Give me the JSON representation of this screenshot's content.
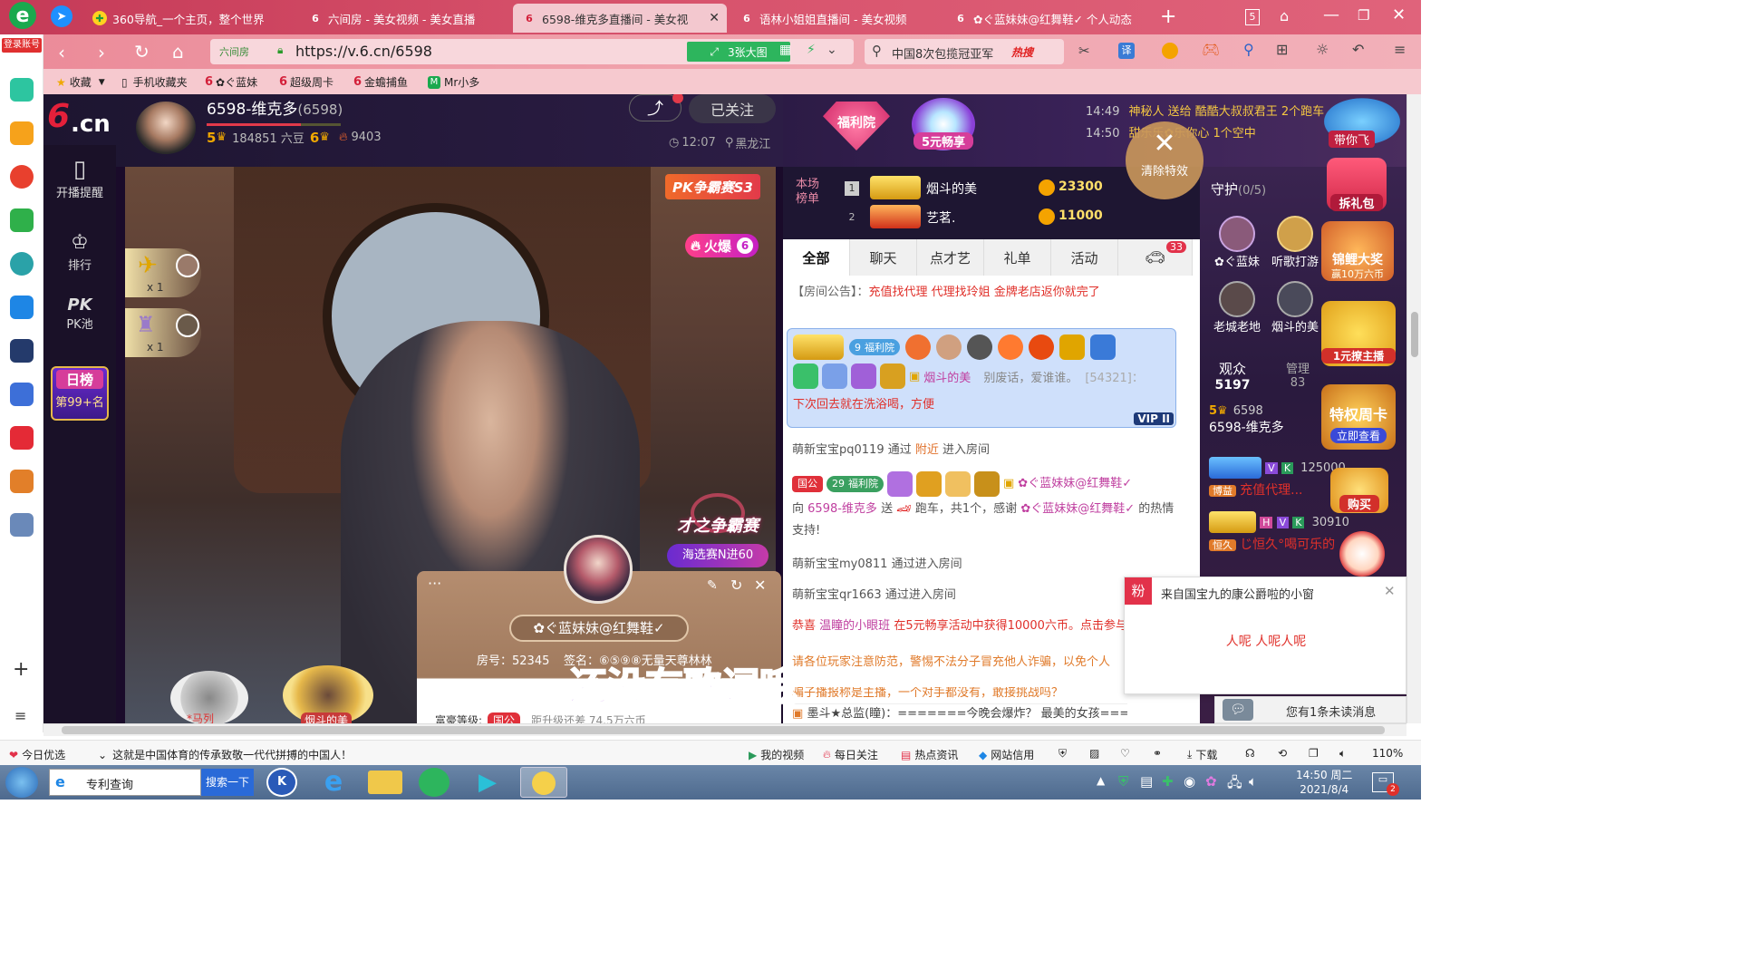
{
  "browser": {
    "login_label": "登录账号",
    "tabs": [
      {
        "label": "360导航_一个主页，整个世界",
        "active": false
      },
      {
        "label": "六间房 - 美女视频 - 美女直播",
        "active": false
      },
      {
        "label": "6598-维克多直播间 - 美女视",
        "active": true
      },
      {
        "label": "语林小姐姐直播间 - 美女视频",
        "active": false
      },
      {
        "label": "✿ぐ蓝妹妹@红舞鞋✓ 个人动态",
        "active": false
      }
    ],
    "tab_count": "5",
    "url": "https://v.6.cn/6598",
    "url_prefix": "六间房",
    "bigpic_label": "3张大图",
    "search_text": "中国8次包揽冠亚军",
    "search_hot": "热搜",
    "translate_label": "译",
    "bookmarks": [
      "收藏",
      "手机收藏夹",
      "✿ぐ蓝妹",
      "超级周卡",
      "金蟾捕鱼",
      "Mr小多"
    ]
  },
  "streamer": {
    "name": "6598-维克多",
    "room_id": "(6598)",
    "level_left": "5",
    "beans": "184851 六豆",
    "level_right": "6",
    "fire": "9403",
    "followed": "已关注",
    "time": "12:07",
    "location": "黑龙江"
  },
  "left_nav": [
    {
      "label": "开播提醒"
    },
    {
      "label": "排行"
    },
    {
      "label": "PK池",
      "title": "PK"
    },
    {
      "label": "日榜",
      "sub": "第99+名"
    }
  ],
  "video": {
    "pk_badge": "PK争霸赛S3",
    "hot_label": "火爆",
    "hot_level": "6",
    "x1a": "x 1",
    "x1b": "x 1",
    "talent_title": "才之争霸赛",
    "talent_sub": "海选赛N进60",
    "lyrics": "还没有歌词哦",
    "bottom_name1": "*马列",
    "bottom_name2": "烟斗的美"
  },
  "popup": {
    "name": "✿ぐ蓝妹妹@红舞鞋✓",
    "room": "房号：52345",
    "sign": "签名：⑥⑤⑨⑧无量天尊林林",
    "rich_label": "富豪等级:",
    "rich_badge": "国公",
    "rich_next": "距升级还差 74.5万六币"
  },
  "top_promo": {
    "welfare": "福利院",
    "five_yuan": "5元畅享",
    "clear_effect": "清除特效",
    "fly_label": "带你飞",
    "feed": [
      {
        "time": "14:49",
        "text": "神秘人 送给 酷酷大叔叔君王 2个跑车"
      },
      {
        "time": "14:50",
        "text": "甜乐乐✿乐你心 1个空中"
      }
    ]
  },
  "ranking": {
    "label": "本场榜单",
    "rows": [
      {
        "rank": "1",
        "name": "烟斗的美",
        "coins": "23300"
      },
      {
        "rank": "2",
        "name": "艺茗.",
        "coins": "11000"
      }
    ]
  },
  "chat": {
    "tabs": [
      "全部",
      "聊天",
      "点才艺",
      "礼单",
      "活动"
    ],
    "car_count": "33",
    "notice_label": "【房间公告】：",
    "notice": "充值找代理 代理找玲姐 金牌老店返你就完了",
    "vip_welfare": "福利院",
    "vip_lvl": "9",
    "vip_user": "烟斗的美",
    "vip_msg": "别废话，爱谁谁。",
    "vip_id": "[54321]：",
    "vip_msg2": "下次回去就在洗浴喝，方便",
    "vip_tag": "VIP II",
    "messages": [
      {
        "user": "萌新宝宝pq0119",
        "mid": "通过",
        "link": "附近",
        "tail": "进入房间"
      },
      {
        "user": "萌新宝宝my0811",
        "tail": "通过进入房间"
      },
      {
        "user": "萌新宝宝qr1663",
        "tail": "通过进入房间"
      }
    ],
    "gift_badge": "国公",
    "gift_lvl": "29",
    "gift_welfare": "福利院",
    "gift_user": "✿ぐ蓝妹妹@红舞鞋✓",
    "gift_to": "向",
    "gift_target": "6598-维克多",
    "gift_send": "送",
    "gift_item": "跑车，共1个，感谢",
    "gift_user2": "✿ぐ蓝妹妹@红舞鞋✓",
    "gift_thanks": "的热情支持!",
    "congrats": "恭喜",
    "congrats_user": "温瞳的小眼班",
    "congrats_msg": "在5元畅享活动中获得10000六币。点击参与",
    "warning": "请各位玩家注意防范，警惕不法分子冒充他人诈骗，以免个人",
    "warning2": "骗子播报称是主播，一个对手都没有，敢接挑战吗？",
    "last_msg": "墨斗★总监(瞳)：=======今晚会爆炸？ 最美的女孩========"
  },
  "guard": {
    "title": "守护",
    "count": "(0/5)",
    "gift_pack": "拆礼包",
    "koi": "锦鲤大奖",
    "koi_sub": "赢10万六币",
    "users": [
      "✿ぐ蓝妹",
      "听歌打游",
      "老城老地",
      "烟斗的美"
    ],
    "one_yuan": "1元撩主播",
    "audience_label": "观众",
    "audience": "5197",
    "admin_label": "管理",
    "admin": "83",
    "viewer_level": "5",
    "viewer_id": "6598",
    "viewer_name": "6598-维克多",
    "special_card": "特权周卡",
    "view_now": "立即查看",
    "buy": "购买",
    "list": [
      {
        "badge": "博益",
        "name": "充值代理...",
        "num": "125000"
      },
      {
        "badge": "恒久",
        "name": "じ恒久°喝可乐的",
        "num": "30910"
      }
    ]
  },
  "fan_window": {
    "tag": "粉",
    "title": "来自国宝九的康公爵啦的小窗",
    "msg": "人呢 人呢人呢",
    "unread": "您有1条未读消息"
  },
  "statusbar": {
    "left1": "今日优选",
    "left2": "这就是中国体育的传承致敬一代代拼搏的中国人！",
    "items": [
      "我的视频",
      "每日关注",
      "热点资讯",
      "网站信用",
      "下载"
    ],
    "zoom": "110%"
  },
  "taskbar": {
    "app_label": "专利查询",
    "search_btn": "搜索一下",
    "time": "14:50 周二",
    "date": "2021/8/4",
    "notif": "2"
  }
}
